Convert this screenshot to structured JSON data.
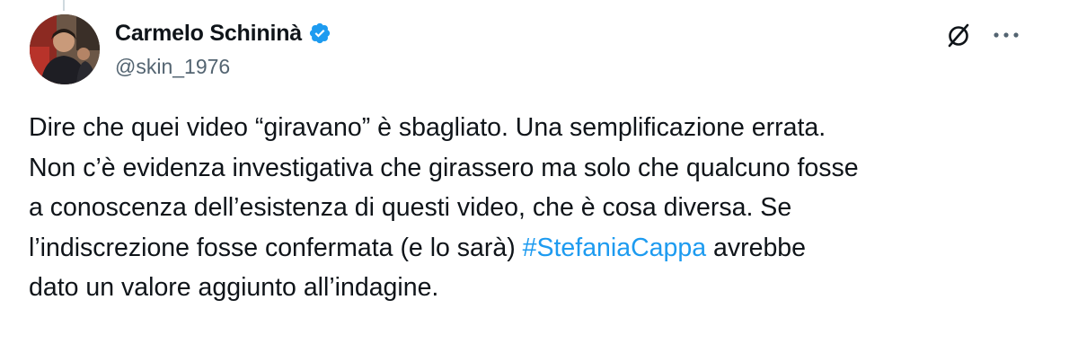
{
  "author": {
    "display_name": "Carmelo Schininà",
    "handle": "@skin_1976",
    "verified": true,
    "avatar_icon": "profile-photo"
  },
  "actions": {
    "grok_icon": "slashed-circle-icon",
    "more_icon": "ellipsis-icon"
  },
  "tweet": {
    "lines": [
      {
        "text": "Dire che quei video “giravano” è sbagliato. Una semplificazione errata."
      },
      {
        "text": "Non c’è evidenza investigativa che girassero ma solo che qualcuno fosse"
      },
      {
        "text": "a conoscenza dell’esistenza di questi video, che è cosa diversa. Se"
      },
      {
        "before": "l’indiscrezione fosse confermata (e lo sarà) ",
        "hashtag": "#StefaniaCappa",
        "after": " avrebbe"
      },
      {
        "text": "dato un valore aggiunto all’indagine."
      }
    ]
  },
  "colors": {
    "text": "#0f1419",
    "secondary": "#536471",
    "accent": "#1d9bf0"
  }
}
